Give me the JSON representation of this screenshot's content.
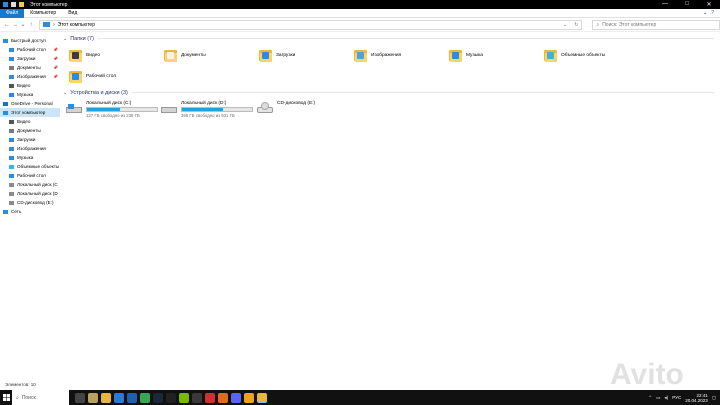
{
  "window": {
    "title": "Этот компьютер",
    "controls": [
      "—",
      "□",
      "✕"
    ]
  },
  "ribbon": {
    "tabs": [
      "Файл",
      "Компьютер",
      "Вид"
    ],
    "collapse_icon": "chevron-down-icon",
    "help_icon": "help-icon"
  },
  "address": {
    "path": "Этот компьютер",
    "search_placeholder": "Поиск: Этот компьютер"
  },
  "sidebar": {
    "items": [
      {
        "label": "Быстрый доступ",
        "icon": "star-icon",
        "color": "#2a8be0"
      },
      {
        "label": "Рабочий стол",
        "icon": "desktop-icon",
        "color": "#2a8be0",
        "pinned": true
      },
      {
        "label": "Загрузки",
        "icon": "download-icon",
        "color": "#2a8be0",
        "pinned": true
      },
      {
        "label": "Документы",
        "icon": "documents-icon",
        "color": "#7a7a7a",
        "pinned": true
      },
      {
        "label": "Изображения",
        "icon": "pictures-icon",
        "color": "#3a8ad0",
        "pinned": true
      },
      {
        "label": "Видео",
        "icon": "video-icon",
        "color": "#555555"
      },
      {
        "label": "Музыка",
        "icon": "music-icon",
        "color": "#2a8be0"
      },
      {
        "label": "OneDrive - Personal",
        "icon": "onedrive-icon",
        "color": "#1a6fd1"
      },
      {
        "label": "Этот компьютер",
        "icon": "computer-icon",
        "color": "#2a8be0",
        "selected": true
      },
      {
        "label": "Видео",
        "icon": "video-icon",
        "color": "#555555"
      },
      {
        "label": "Документы",
        "icon": "documents-icon",
        "color": "#7a7a7a"
      },
      {
        "label": "Загрузки",
        "icon": "download-icon",
        "color": "#2a8be0"
      },
      {
        "label": "Изображения",
        "icon": "pictures-icon",
        "color": "#3a8ad0"
      },
      {
        "label": "Музыка",
        "icon": "music-icon",
        "color": "#2a8be0"
      },
      {
        "label": "Объемные объекты",
        "icon": "3d-objects-icon",
        "color": "#39b5d8"
      },
      {
        "label": "Рабочий стол",
        "icon": "desktop-icon",
        "color": "#2a8be0"
      },
      {
        "label": "Локальный диск (C",
        "icon": "drive-icon",
        "color": "#8a8a8a"
      },
      {
        "label": "Локальный диск (D",
        "icon": "drive-icon",
        "color": "#8a8a8a"
      },
      {
        "label": "CD-дисковод (E:)",
        "icon": "cd-drive-icon",
        "color": "#8a8a8a"
      },
      {
        "label": "Сеть",
        "icon": "network-icon",
        "color": "#2a8be0"
      }
    ]
  },
  "folders_group": {
    "header": "Папки (7)",
    "items": [
      {
        "label": "Видео",
        "icon": "video-folder-icon",
        "badge": "#3b3b3b"
      },
      {
        "label": "Документы",
        "icon": "documents-folder-icon",
        "badge": "#f3f3f3"
      },
      {
        "label": "Загрузки",
        "icon": "downloads-folder-icon",
        "badge": "#2a8be0"
      },
      {
        "label": "Изображения",
        "icon": "pictures-folder-icon",
        "badge": "#4aa3e0"
      },
      {
        "label": "Музыка",
        "icon": "music-folder-icon",
        "badge": "#2a8be0"
      },
      {
        "label": "Объемные объекты",
        "icon": "3d-objects-folder-icon",
        "badge": "#39b5d8"
      },
      {
        "label": "Рабочий стол",
        "icon": "desktop-folder-icon",
        "badge": "#2a8be0"
      }
    ]
  },
  "drives_group": {
    "header": "Устройства и диски (3)",
    "items": [
      {
        "label": "Локальный диск (C:)",
        "free": "127 ГБ свободно из 238 ГБ",
        "used_fraction": 0.47,
        "icon": "windows-drive-icon",
        "has_bar": true
      },
      {
        "label": "Локальный диск (D:)",
        "free": "395 ГБ свободно из 931 ГБ",
        "used_fraction": 0.58,
        "icon": "drive-icon",
        "has_bar": true
      },
      {
        "label": "CD-дисковод (E:)",
        "free": "",
        "icon": "cd-drive-icon",
        "has_bar": false
      }
    ]
  },
  "status": {
    "text": "Элементов: 10"
  },
  "taskbar": {
    "search_placeholder": "Поиск",
    "apps": [
      {
        "icon": "task-view-icon",
        "color": "#444444"
      },
      {
        "icon": "game-app-icon",
        "color": "#b8a060"
      },
      {
        "icon": "explorer-icon",
        "color": "#e6b63f"
      },
      {
        "icon": "mail-icon",
        "color": "#2a7bd6"
      },
      {
        "icon": "store-icon",
        "color": "#1c5fb3"
      },
      {
        "icon": "chrome-icon",
        "color": "#34a853"
      },
      {
        "icon": "steam-icon",
        "color": "#1b2838"
      },
      {
        "icon": "terminal-icon",
        "color": "#222222"
      },
      {
        "icon": "nvidia-icon",
        "color": "#76b900"
      },
      {
        "icon": "app-icon",
        "color": "#3a3a3a"
      },
      {
        "icon": "record-icon",
        "color": "#d03030"
      },
      {
        "icon": "messenger-icon",
        "color": "#e06b1a"
      },
      {
        "icon": "discord-icon",
        "color": "#5865f2"
      },
      {
        "icon": "app-orange-icon",
        "color": "#f0a020"
      },
      {
        "icon": "explorer-active-icon",
        "color": "#e6b63f"
      }
    ],
    "tray": {
      "lang": "РУС",
      "time": "22:41",
      "date": "20.04.2023"
    }
  },
  "watermark": {
    "text": "Avito"
  },
  "accent": "#1979ca"
}
